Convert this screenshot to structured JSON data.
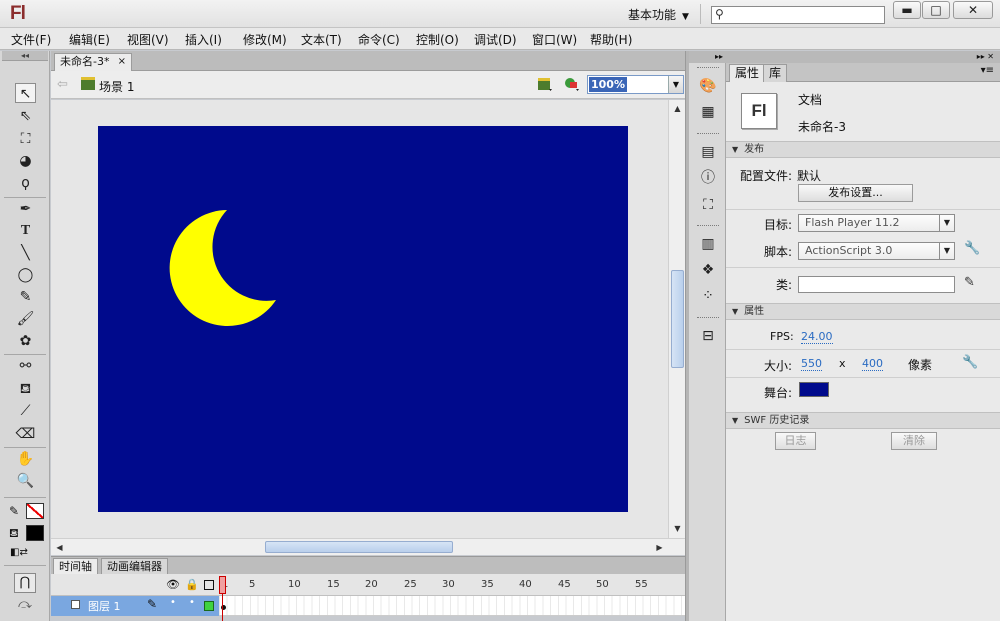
{
  "app": {
    "logo": "Fl"
  },
  "titlebar": {
    "workspace": "基本功能",
    "search_placeholder": "",
    "min_label": "▬",
    "max_label": "□",
    "close_label": "✕"
  },
  "menu": [
    "文件(F)",
    "编辑(E)",
    "视图(V)",
    "插入(I)",
    "修改(M)",
    "文本(T)",
    "命令(C)",
    "控制(O)",
    "调试(D)",
    "窗口(W)",
    "帮助(H)"
  ],
  "document": {
    "tab_title": "未命名-3*",
    "tab_close": "×",
    "scene_label": "场景 1",
    "zoom": "100%",
    "stage_color": "#000a8c",
    "moon_color": "#ffff00"
  },
  "timeline": {
    "tabs": [
      "时间轴",
      "动画编辑器"
    ],
    "frame_numbers": [
      "1",
      "5",
      "10",
      "15",
      "20",
      "25",
      "30",
      "35",
      "40",
      "45",
      "50",
      "55"
    ],
    "layer_name": "图层 1"
  },
  "properties": {
    "tabs": [
      "属性",
      "库"
    ],
    "doc_icon": "Fl",
    "doc_type": "文档",
    "doc_name": "未命名-3",
    "publish_section": "发布",
    "profile_label": "配置文件:",
    "profile_value": "默认",
    "publish_settings_button": "发布设置...",
    "target_label": "目标:",
    "target_value": "Flash Player 11.2",
    "script_label": "脚本:",
    "script_value": "ActionScript 3.0",
    "class_label": "类:",
    "class_value": "",
    "attributes_section": "属性",
    "fps_label": "FPS:",
    "fps_value": "24.00",
    "size_label": "大小:",
    "width_value": "550",
    "size_x": "x",
    "height_value": "400",
    "size_unit": "像素",
    "stage_label": "舞台:",
    "stage_color": "#000a8c",
    "swf_section": "SWF 历史记录",
    "log_button": "日志",
    "clear_button": "清除"
  }
}
